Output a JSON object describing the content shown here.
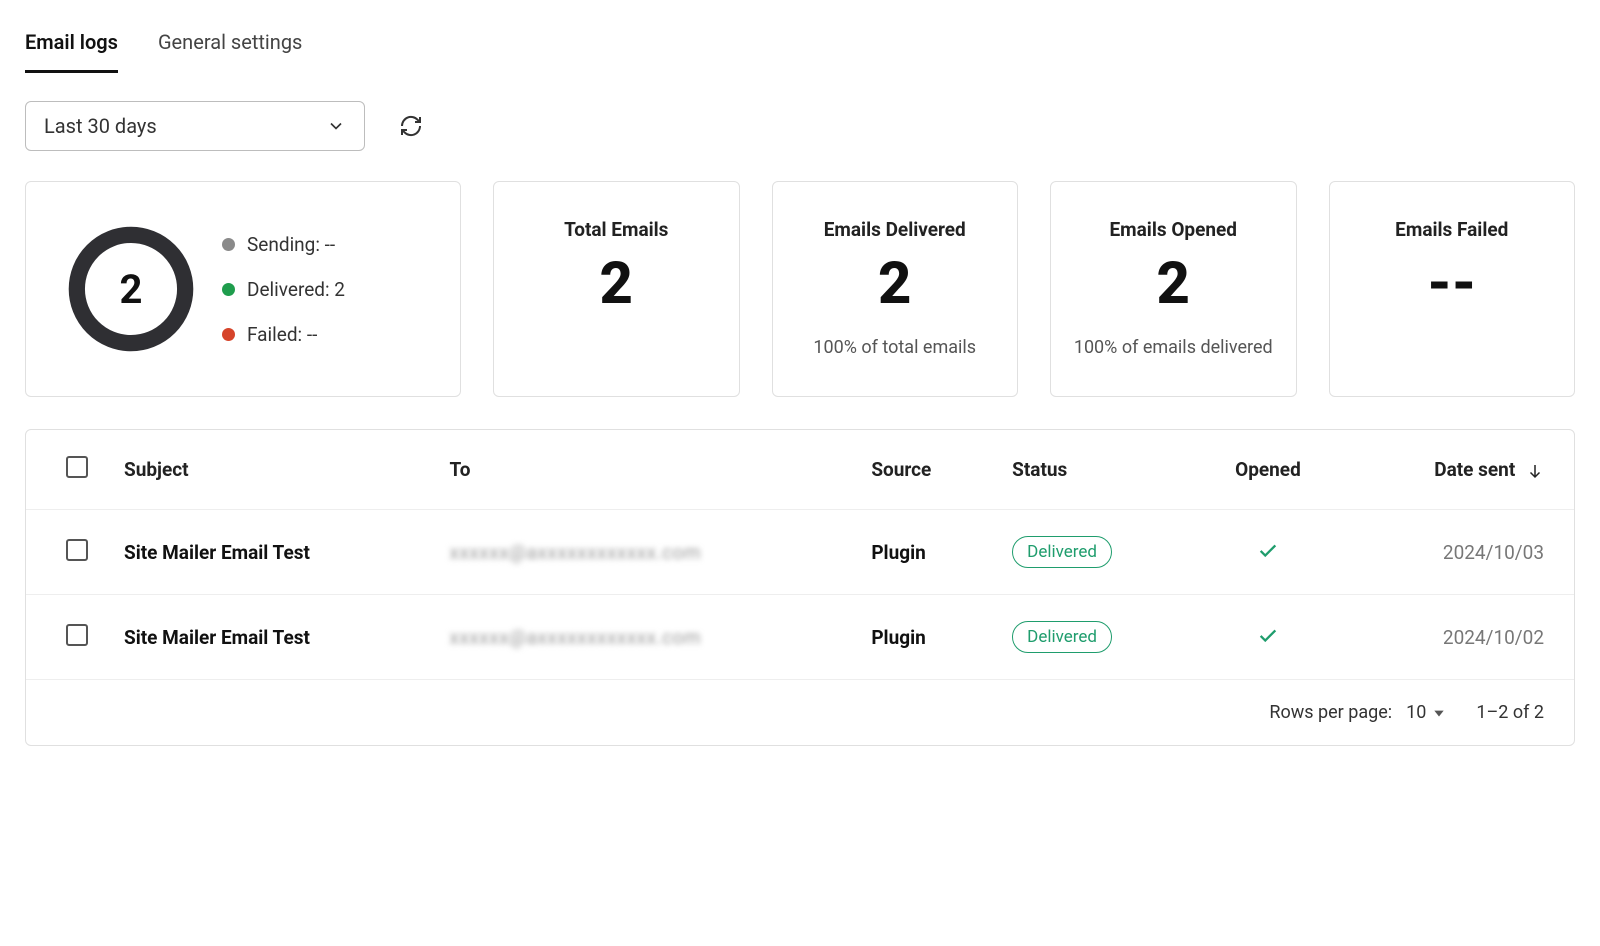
{
  "tabs": {
    "email_logs": "Email logs",
    "general_settings": "General settings"
  },
  "filters": {
    "date_range": "Last 30 days"
  },
  "summary": {
    "total": "2",
    "legend": {
      "sending_label": "Sending: --",
      "delivered_label": "Delivered: 2",
      "failed_label": "Failed: --"
    }
  },
  "stats": {
    "total_emails": {
      "title": "Total Emails",
      "value": "2",
      "sub": ""
    },
    "delivered": {
      "title": "Emails Delivered",
      "value": "2",
      "sub": "100% of total emails"
    },
    "opened": {
      "title": "Emails Opened",
      "value": "2",
      "sub": "100% of emails delivered"
    },
    "failed": {
      "title": "Emails Failed",
      "value": "--",
      "sub": ""
    }
  },
  "table": {
    "headers": {
      "subject": "Subject",
      "to": "To",
      "source": "Source",
      "status": "Status",
      "opened": "Opened",
      "date_sent": "Date sent"
    },
    "rows": [
      {
        "subject": "Site Mailer Email Test",
        "to": "xxxxxx@axxxxxxxxxxxx.com",
        "source": "Plugin",
        "status": "Delivered",
        "opened": true,
        "date": "2024/10/03"
      },
      {
        "subject": "Site Mailer Email Test",
        "to": "xxxxxx@axxxxxxxxxxxx.com",
        "source": "Plugin",
        "status": "Delivered",
        "opened": true,
        "date": "2024/10/02"
      }
    ]
  },
  "pagination": {
    "rows_label": "Rows per page:",
    "rows_value": "10",
    "range": "1–2 of 2"
  }
}
